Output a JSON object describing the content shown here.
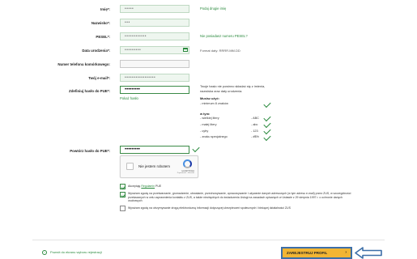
{
  "form": {
    "first_name": {
      "label": "Imię*:",
      "value": "•••••"
    },
    "last_name": {
      "label": "Nazwisko*:",
      "value": "•••"
    },
    "pesel": {
      "label": "PESEL*:",
      "value": "••••••••••••"
    },
    "birth_date": {
      "label": "Data urodzenia*:",
      "value": "•••••••••"
    },
    "phone": {
      "label": "Numer telefonu komórkowego:",
      "value": ""
    },
    "email": {
      "label": "Twój e-mail*:",
      "value": "•••••••••••••••••"
    },
    "password": {
      "label": "Zdefiniuj hasło do PUE*:",
      "value": "•••••••••"
    },
    "password_repeat": {
      "label": "Powtórz hasło do PUE*:",
      "value": "•••••••••"
    }
  },
  "links": {
    "second_name": "Podaj drugie imię",
    "no_pesel": "Nie posiadasz numeru PESEL?",
    "show_password": "Pokaż hasło"
  },
  "hints": {
    "date_format": "Format daty: RRRR.MM.DD",
    "pass_line1": "Twoje hasło nie powinno składać się z imienia,",
    "pass_line2": "nazwiska oraz daty urodzenia.",
    "must_contain": "Musisz użyć:",
    "min_chars": "- minimum 8 znaków",
    "in_that": "w tym:",
    "req_lower": "- małej litery",
    "req_upper": "- wielkiej litery",
    "req_digit": "- cyfry",
    "req_special": "- znaku specjalnego",
    "ex_upper": "- ABC",
    "ex_lower": "- abc",
    "ex_digit": "- 123",
    "ex_special": "- #$%"
  },
  "captcha": {
    "label": "Nie jestem robotem",
    "brand": "reCAPTCHA",
    "small": "Prywatność - Warunki"
  },
  "consents": {
    "accept_prefix": "Akceptuję ",
    "accept_link": "Regulamin",
    "accept_suffix": " PUE",
    "consent1": "Wyrażam zgodę na przetwarzanie, gromadzenie, utrwalanie, przechowywanie, opracowywanie i używanie danych adresowych (w tym adresu e-mail) przez ZUS, w szczególności przekazanych w celu usprawnienia kontaktu z ZUS, a także niezbędnych do świadczenia Usługi na zasadach opisanych w Ustawie z 29 sierpnia 1997 r. o ochronie danych osobowych",
    "consent2": "Wyrażam zgodę na otrzymywanie drogą elektroniczną informacji dotyczącej ubezpieczeń społecznych i bieżącej działalności ZUS"
  },
  "footer": {
    "back_label": "Powrót do ekranu wyboru rejestracji",
    "submit_label": "ZAREJESTRUJ PROFIL",
    "submit_arrow": "›"
  },
  "colors": {
    "accent": "#2b8a3e",
    "button": "#f2b533",
    "highlight": "#3d6fa8"
  }
}
